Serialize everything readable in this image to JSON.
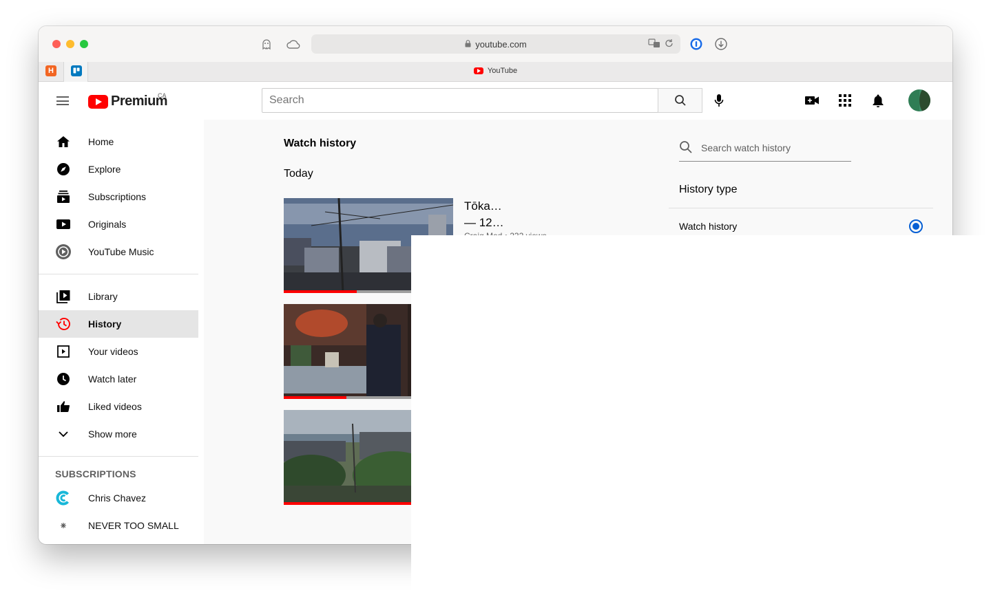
{
  "browser": {
    "url": "youtube.com",
    "tab_title": "YouTube",
    "pinned_tabs": [
      "H",
      "T"
    ]
  },
  "header": {
    "logo_text": "Premium",
    "region": "CA",
    "search_placeholder": "Search"
  },
  "sidebar": {
    "primary": [
      {
        "label": "Home",
        "icon": "home-icon"
      },
      {
        "label": "Explore",
        "icon": "compass-icon"
      },
      {
        "label": "Subscriptions",
        "icon": "subscriptions-icon"
      },
      {
        "label": "Originals",
        "icon": "originals-icon"
      },
      {
        "label": "YouTube Music",
        "icon": "music-icon"
      }
    ],
    "secondary": [
      {
        "label": "Library",
        "icon": "library-icon"
      },
      {
        "label": "History",
        "icon": "history-icon",
        "active": true
      },
      {
        "label": "Your videos",
        "icon": "your-videos-icon"
      },
      {
        "label": "Watch later",
        "icon": "clock-icon"
      },
      {
        "label": "Liked videos",
        "icon": "thumbs-up-icon"
      },
      {
        "label": "Show more",
        "icon": "chevron-down-icon"
      }
    ],
    "subscriptions_heading": "SUBSCRIPTIONS",
    "subscriptions": [
      {
        "label": "Chris Chavez"
      },
      {
        "label": "NEVER TOO SMALL"
      }
    ]
  },
  "main": {
    "page_title": "Watch history",
    "section": "Today",
    "videos": [
      {
        "title_line1": "Tōka…",
        "title_line2": "— 12…",
        "meta": "Craig Mod • 232 views",
        "progress": 0.43
      },
      {
        "progress": 0.37
      },
      {
        "progress": 1.0
      }
    ]
  },
  "history_panel": {
    "search_placeholder": "Search watch history",
    "type_title": "History type",
    "option": "Watch history"
  },
  "colors": {
    "brand_red": "#ff0000",
    "accent_blue": "#065fd4"
  }
}
